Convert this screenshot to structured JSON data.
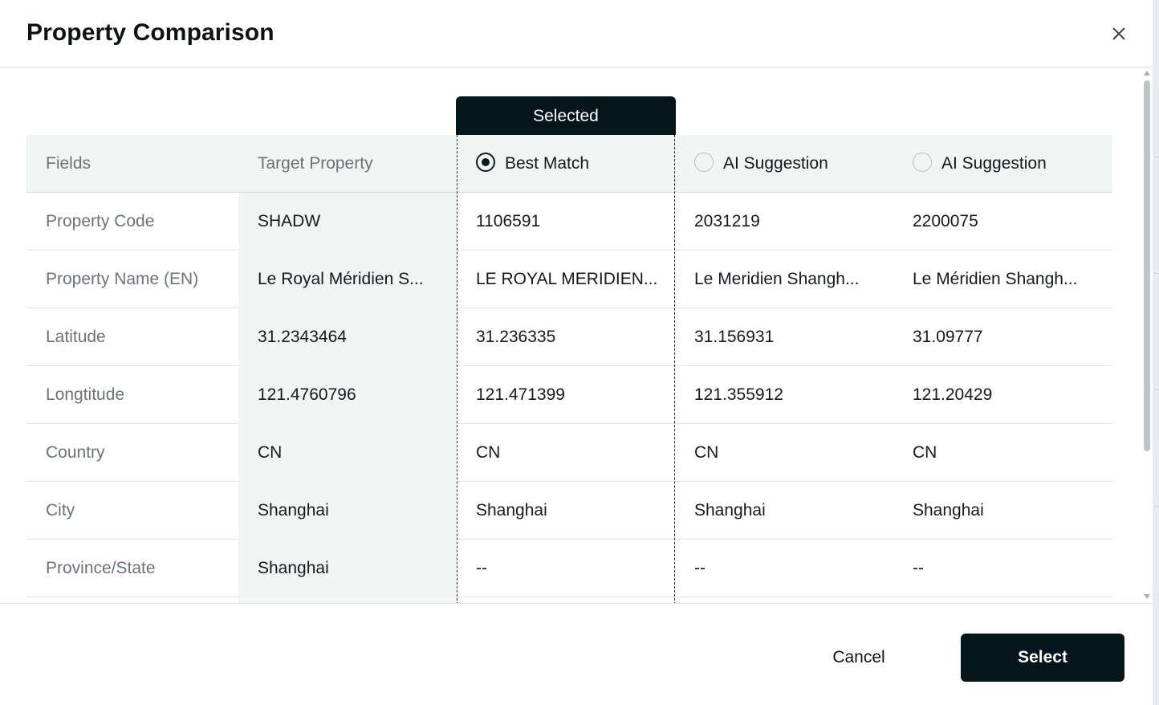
{
  "dialog": {
    "title": "Property Comparison",
    "close_icon": "close-icon"
  },
  "selected_tab": {
    "label": "Selected"
  },
  "table": {
    "headers": {
      "fields": "Fields",
      "target": "Target Property",
      "col2": {
        "label": "Best Match",
        "checked": true
      },
      "col3": {
        "label": "AI Suggestion",
        "checked": false
      },
      "col4": {
        "label": "AI Suggestion",
        "checked": false
      }
    },
    "rows": [
      {
        "field": "Property Code",
        "target": "SHADW",
        "c2": "1106591",
        "c3": "2031219",
        "c4": "2200075"
      },
      {
        "field": "Property Name (EN)",
        "target": "Le Royal Méridien S...",
        "c2": "LE ROYAL MERIDIEN...",
        "c3": "Le Meridien Shangh...",
        "c4": "Le Méridien Shangh..."
      },
      {
        "field": "Latitude",
        "target": "31.2343464",
        "c2": "31.236335",
        "c3": "31.156931",
        "c4": "31.09777"
      },
      {
        "field": "Longtitude",
        "target": "121.4760796",
        "c2": "121.471399",
        "c3": "121.355912",
        "c4": "121.20429"
      },
      {
        "field": "Country",
        "target": "CN",
        "c2": "CN",
        "c3": "CN",
        "c4": "CN"
      },
      {
        "field": "City",
        "target": "Shanghai",
        "c2": "Shanghai",
        "c3": "Shanghai",
        "c4": "Shanghai"
      },
      {
        "field": "Province/State",
        "target": "Shanghai",
        "c2": "--",
        "c3": "--",
        "c4": "--"
      },
      {
        "field": "",
        "target": "",
        "c2": "",
        "c3": "",
        "c4": ""
      }
    ]
  },
  "footer": {
    "cancel_label": "Cancel",
    "select_label": "Select"
  },
  "colors": {
    "primary_dark": "#06141b",
    "header_bg": "#f3f5f5",
    "muted_text": "#6b7278"
  }
}
